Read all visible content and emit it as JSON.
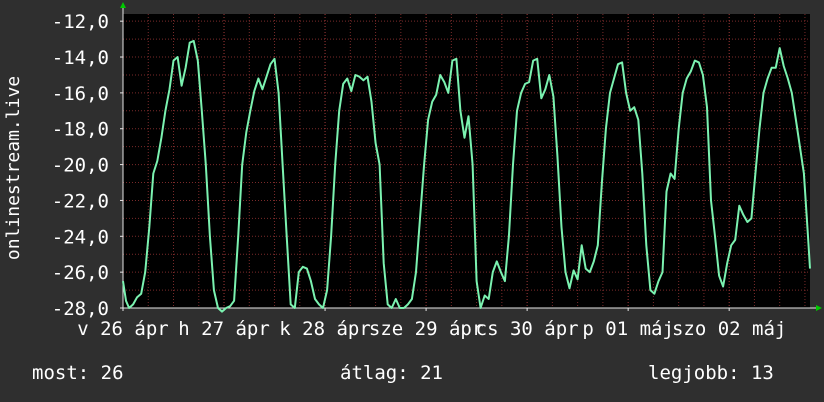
{
  "chart_data": {
    "type": "line",
    "ylabel": "onlinestream.live",
    "ylim": [
      -28.0,
      -11.6
    ],
    "y_ticks": [
      "-12,0",
      "-14,0",
      "-16,0",
      "-18,0",
      "-20,0",
      "-22,0",
      "-24,0",
      "-26,0",
      "-28,0"
    ],
    "y_tick_values": [
      -12,
      -14,
      -16,
      -18,
      -20,
      -22,
      -24,
      -26,
      -28
    ],
    "x_ticks": [
      "v 26 ápr",
      "h 27 ápr",
      "k 28 ápr",
      "sze 29 ápr",
      "cs 30 ápr",
      "p 01 máj",
      "szo 02 máj"
    ],
    "grid": true,
    "colors": {
      "background": "#000000",
      "line": "#7bf2b0",
      "grid": "#7a2a2a",
      "axis": "#e6e6e6",
      "arrow": "#00c800"
    },
    "series": [
      {
        "x_days": [
          0.0,
          0.03,
          0.06,
          0.1,
          0.14,
          0.18,
          0.22,
          0.26,
          0.3,
          0.34,
          0.38,
          0.42,
          0.46,
          0.5,
          0.54,
          0.58,
          0.62,
          0.66,
          0.7,
          0.74,
          0.78,
          0.82,
          0.86,
          0.9,
          0.94,
          0.98,
          1.02,
          1.06,
          1.1,
          1.14,
          1.18,
          1.22,
          1.26,
          1.3,
          1.34,
          1.38,
          1.42,
          1.46,
          1.5,
          1.54,
          1.58,
          1.62,
          1.66,
          1.7,
          1.74,
          1.78,
          1.82,
          1.86,
          1.9,
          1.94,
          1.98,
          2.02,
          2.06,
          2.1,
          2.14,
          2.18,
          2.22,
          2.26,
          2.3,
          2.34,
          2.38,
          2.42,
          2.46,
          2.5,
          2.54,
          2.58,
          2.62,
          2.66,
          2.7,
          2.74,
          2.78,
          2.82,
          2.86,
          2.9,
          2.94,
          2.98,
          3.02,
          3.06,
          3.1,
          3.14,
          3.18,
          3.22,
          3.26,
          3.3,
          3.34,
          3.38,
          3.42,
          3.46,
          3.5,
          3.54,
          3.58,
          3.62,
          3.66,
          3.7,
          3.74,
          3.78,
          3.82,
          3.86,
          3.9,
          3.94,
          3.98,
          4.02,
          4.06,
          4.1,
          4.14,
          4.18,
          4.22,
          4.26,
          4.3,
          4.34,
          4.38,
          4.42,
          4.46,
          4.5,
          4.54,
          4.58,
          4.62,
          4.66,
          4.7,
          4.74,
          4.78,
          4.82,
          4.86,
          4.9,
          4.94,
          4.98,
          5.02,
          5.06,
          5.1,
          5.14,
          5.18,
          5.22,
          5.26,
          5.3,
          5.34,
          5.38,
          5.42,
          5.46,
          5.5,
          5.54,
          5.58,
          5.62,
          5.66,
          5.7,
          5.74,
          5.78,
          5.82,
          5.86,
          5.9,
          5.94,
          5.98,
          6.02,
          6.06,
          6.1,
          6.14,
          6.18,
          6.22,
          6.26,
          6.3,
          6.34,
          6.38,
          6.42,
          6.46,
          6.5,
          6.54,
          6.58,
          6.62,
          6.66,
          6.7,
          6.74,
          6.78,
          6.8
        ],
        "values": [
          -26.5,
          -27.6,
          -28.0,
          -27.8,
          -27.4,
          -27.2,
          -26.0,
          -23.5,
          -20.5,
          -19.8,
          -18.5,
          -17.0,
          -15.8,
          -14.2,
          -14.0,
          -15.6,
          -14.6,
          -13.2,
          -13.1,
          -14.2,
          -17.0,
          -20.0,
          -24.0,
          -27.0,
          -28.0,
          -28.2,
          -28.0,
          -27.9,
          -27.6,
          -24.0,
          -20.0,
          -18.2,
          -17.0,
          -15.9,
          -15.2,
          -15.8,
          -15.1,
          -14.4,
          -14.1,
          -16.0,
          -20.0,
          -24.0,
          -27.8,
          -28.0,
          -26.0,
          -25.7,
          -25.8,
          -26.5,
          -27.5,
          -27.8,
          -28.0,
          -27.0,
          -24.0,
          -20.0,
          -17.0,
          -15.5,
          -15.2,
          -15.9,
          -15.0,
          -15.1,
          -15.3,
          -15.1,
          -16.5,
          -18.8,
          -20.0,
          -25.5,
          -27.8,
          -28.0,
          -27.5,
          -28.0,
          -28.0,
          -27.8,
          -27.5,
          -26.0,
          -23.0,
          -20.0,
          -17.5,
          -16.5,
          -16.1,
          -15.0,
          -15.4,
          -16.0,
          -14.2,
          -14.1,
          -17.0,
          -18.5,
          -17.3,
          -20.0,
          -26.5,
          -28.0,
          -27.3,
          -27.5,
          -26.0,
          -25.4,
          -26.0,
          -26.5,
          -24.0,
          -20.0,
          -17.0,
          -16.0,
          -15.5,
          -15.4,
          -14.2,
          -14.1,
          -16.3,
          -15.8,
          -15.0,
          -16.2,
          -19.5,
          -23.5,
          -26.0,
          -26.9,
          -25.9,
          -26.4,
          -24.5,
          -25.8,
          -26.0,
          -25.4,
          -24.5,
          -21.0,
          -18.0,
          -16.0,
          -15.2,
          -14.4,
          -14.3,
          -16.0,
          -17.0,
          -16.8,
          -17.5,
          -20.5,
          -24.5,
          -27.0,
          -27.2,
          -26.5,
          -26.0,
          -21.5,
          -20.5,
          -20.8,
          -18.0,
          -16.0,
          -15.2,
          -14.8,
          -14.2,
          -14.3,
          -15.0,
          -16.8,
          -22.0,
          -24.0,
          -26.2,
          -26.8,
          -25.5,
          -24.5,
          -24.2,
          -22.3,
          -22.8,
          -23.2,
          -23.0,
          -20.5,
          -18.0,
          -16.0,
          -15.2,
          -14.6,
          -14.6,
          -13.5,
          -14.5,
          -15.2,
          -16.0,
          -17.5,
          -19.0,
          -20.5,
          -24.0,
          -25.8
        ]
      }
    ]
  },
  "stats": {
    "now": "most: 26",
    "avg": "átlag: 21",
    "best": "legjobb: 13"
  }
}
